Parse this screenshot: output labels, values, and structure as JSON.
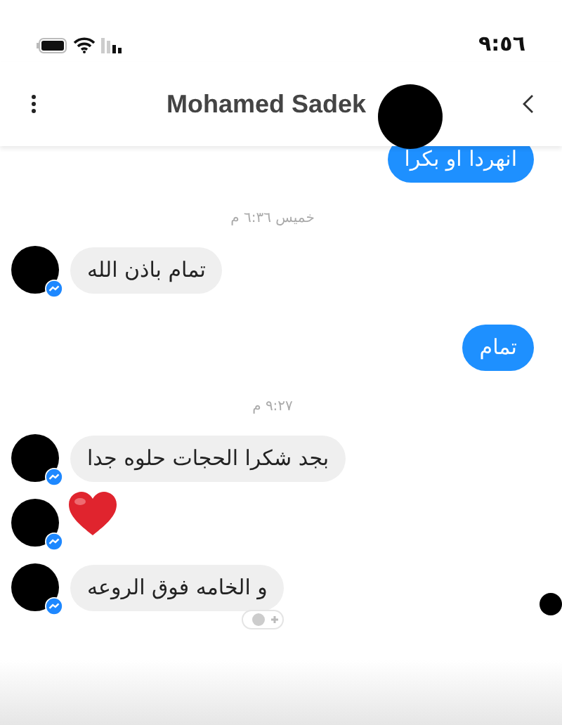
{
  "status_bar": {
    "time": "٩:٥٦"
  },
  "header": {
    "title": "Mohamed Sadek"
  },
  "messages": [
    {
      "kind": "sent",
      "text": "انهردا او بكرا"
    },
    {
      "kind": "timestamp",
      "text": "خميس ٦:٣٦ م"
    },
    {
      "kind": "received",
      "text": "تمام باذن الله"
    },
    {
      "kind": "sent",
      "text": "تمام"
    },
    {
      "kind": "timestamp",
      "text": "٩:٢٧ م"
    },
    {
      "kind": "received",
      "text": "بجد شكرا الحجات حلوه جدا"
    },
    {
      "kind": "heart"
    },
    {
      "kind": "received",
      "text": "و الخامه فوق الروعه",
      "reaction_button": true
    }
  ]
}
